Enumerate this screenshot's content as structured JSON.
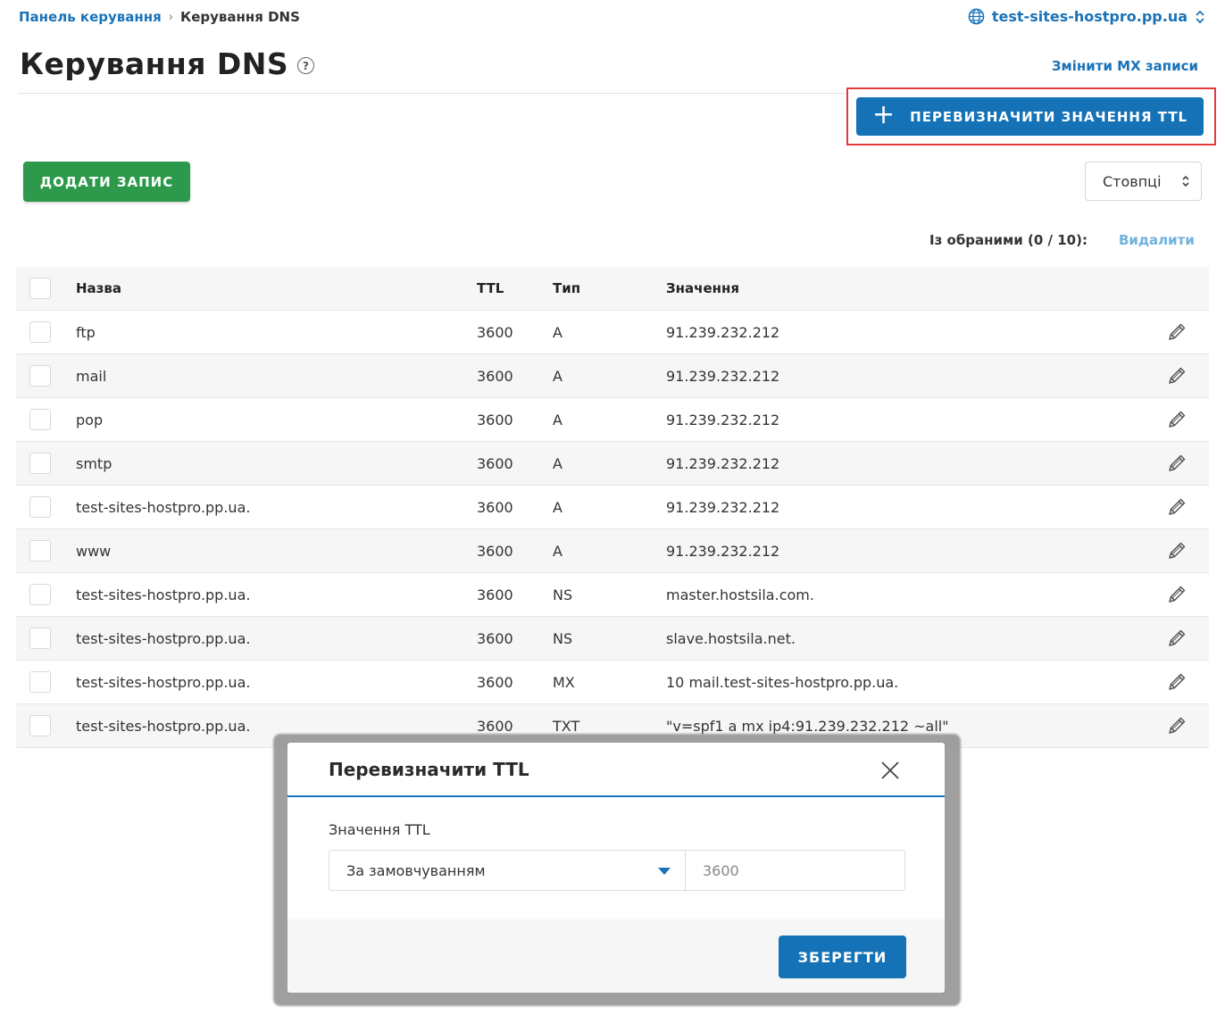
{
  "breadcrumb": {
    "root": "Панель керування",
    "separator": "›",
    "current": "Керування DNS"
  },
  "domain": {
    "name": "test-sites-hostpro.pp.ua",
    "icon": "globe-icon"
  },
  "page": {
    "title": "Керування DNS",
    "help_glyph": "?"
  },
  "links": {
    "change_mx": "Змінити MX записи"
  },
  "buttons": {
    "override_ttl": "ПЕРЕВИЗНАЧИТИ ЗНАЧЕННЯ TTL",
    "override_ttl_plus": "+",
    "add_record": "ДОДАТИ ЗАПИС"
  },
  "columns_select": {
    "label": "Стовпці"
  },
  "selection": {
    "info": "Із обраними (0 / 10):",
    "delete": "Видалити"
  },
  "table": {
    "headers": {
      "name": "Назва",
      "ttl": "TTL",
      "type": "Тип",
      "value": "Значення"
    },
    "rows": [
      {
        "name": "ftp",
        "ttl": "3600",
        "type": "A",
        "value": "91.239.232.212"
      },
      {
        "name": "mail",
        "ttl": "3600",
        "type": "A",
        "value": "91.239.232.212"
      },
      {
        "name": "pop",
        "ttl": "3600",
        "type": "A",
        "value": "91.239.232.212"
      },
      {
        "name": "smtp",
        "ttl": "3600",
        "type": "A",
        "value": "91.239.232.212"
      },
      {
        "name": "test-sites-hostpro.pp.ua.",
        "ttl": "3600",
        "type": "A",
        "value": "91.239.232.212"
      },
      {
        "name": "www",
        "ttl": "3600",
        "type": "A",
        "value": "91.239.232.212"
      },
      {
        "name": "test-sites-hostpro.pp.ua.",
        "ttl": "3600",
        "type": "NS",
        "value": "master.hostsila.com."
      },
      {
        "name": "test-sites-hostpro.pp.ua.",
        "ttl": "3600",
        "type": "NS",
        "value": "slave.hostsila.net."
      },
      {
        "name": "test-sites-hostpro.pp.ua.",
        "ttl": "3600",
        "type": "MX",
        "value": "10 mail.test-sites-hostpro.pp.ua."
      },
      {
        "name": "test-sites-hostpro.pp.ua.",
        "ttl": "3600",
        "type": "TXT",
        "value": "\"v=spf1 a mx ip4:91.239.232.212 ~all\""
      }
    ]
  },
  "modal": {
    "title": "Перевизначити TTL",
    "field_label": "Значення TTL",
    "select_value": "За замовчуванням",
    "input_placeholder": "3600",
    "save": "ЗБЕРЕГТИ"
  },
  "colors": {
    "primary": "#1572b6",
    "success": "#2c9a4a",
    "highlight": "#e23b3b",
    "link_muted": "#6fb2df"
  }
}
